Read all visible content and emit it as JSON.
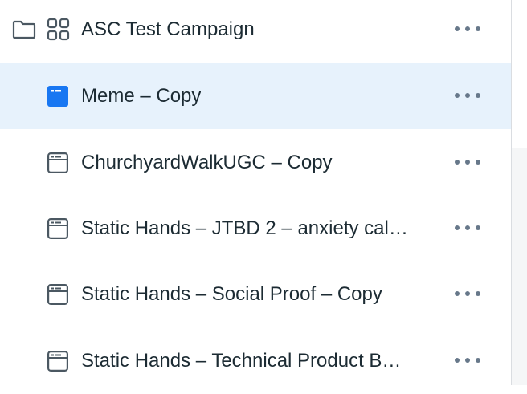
{
  "campaign": {
    "name": "ASC Test Campaign",
    "icons": [
      "folder-icon",
      "campaign-grid-icon"
    ],
    "more_icon": "more-options-icon"
  },
  "ads": [
    {
      "name": "Meme – Copy",
      "selected": true,
      "icon": "ad-icon"
    },
    {
      "name": "ChurchyardWalkUGC – Copy",
      "selected": false,
      "icon": "ad-icon"
    },
    {
      "name": "Static Hands – JTBD 2 – anxiety cal…",
      "selected": false,
      "icon": "ad-icon"
    },
    {
      "name": "Static Hands – Social Proof – Copy",
      "selected": false,
      "icon": "ad-icon"
    },
    {
      "name": "Static Hands – Technical Product B…",
      "selected": false,
      "icon": "ad-icon"
    }
  ],
  "colors": {
    "selected_bg": "#e7f2fc",
    "accent": "#1877f2",
    "text": "#1c2b33",
    "icon": "#4b5862"
  }
}
